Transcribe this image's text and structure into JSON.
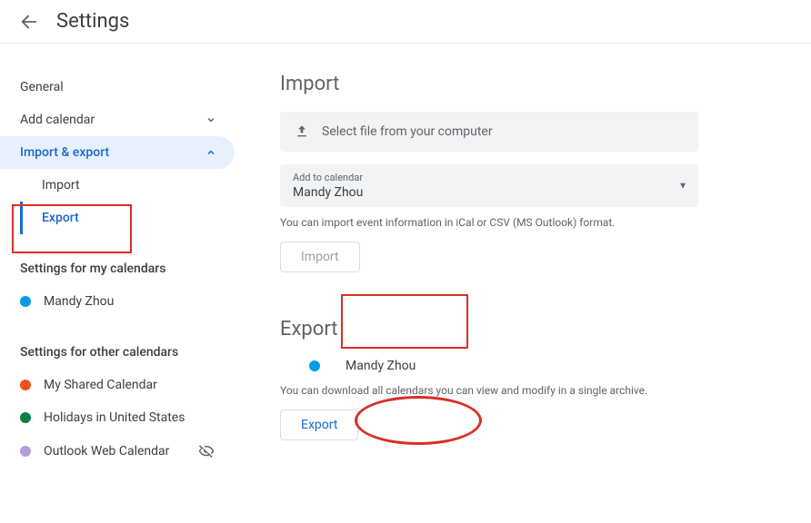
{
  "header": {
    "title": "Settings"
  },
  "sidebar": {
    "general": "General",
    "add_calendar": "Add calendar",
    "import_export": "Import & export",
    "sub": {
      "import": "Import",
      "export": "Export"
    },
    "my_cal_title": "Settings for my calendars",
    "my_cals": [
      {
        "name": "Mandy Zhou",
        "color": "#039be5"
      }
    ],
    "other_cal_title": "Settings for other calendars",
    "other_cals": [
      {
        "name": "My Shared Calendar",
        "color": "#f4511e",
        "hidden": false
      },
      {
        "name": "Holidays in United States",
        "color": "#0b8043",
        "hidden": false
      },
      {
        "name": "Outlook Web Calendar",
        "color": "#b39ddb",
        "hidden": true
      }
    ]
  },
  "import_panel": {
    "title": "Import",
    "select_file": "Select file from your computer",
    "add_to_label": "Add to calendar",
    "add_to_value": "Mandy Zhou",
    "help": "You can import event information in iCal or CSV (MS Outlook) format.",
    "button": "Import"
  },
  "export_panel": {
    "title": "Export",
    "cal": {
      "name": "Mandy Zhou",
      "color": "#039be5"
    },
    "help": "You can download all calendars you can view and modify in a single archive.",
    "button": "Export"
  }
}
